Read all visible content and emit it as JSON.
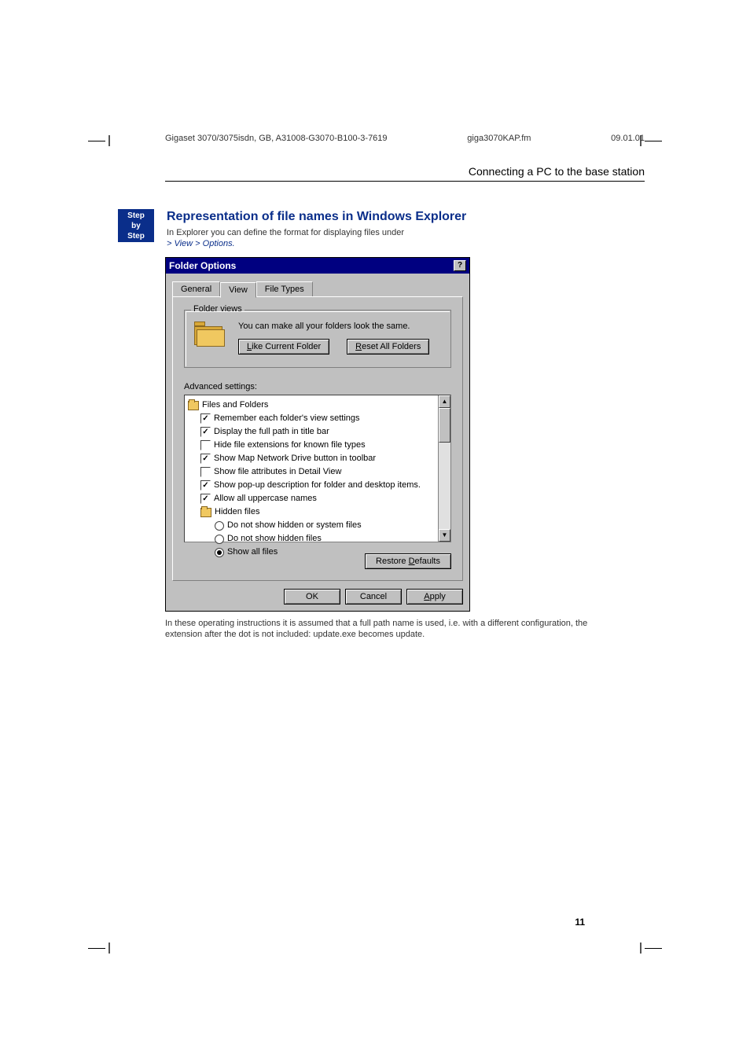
{
  "doc": {
    "header_left": "Gigaset 3070/3075isdn, GB, A31008-G3070-B100-3-7619",
    "header_mid": "giga3070KAP.fm",
    "header_right": "09.01.01",
    "section_title": "Connecting a PC to the base station",
    "step_badge_l1": "Step",
    "step_badge_l2": "by",
    "step_badge_l3": "Step",
    "heading": "Representation of file names in Windows Explorer",
    "intro_before": "In Explorer you can define the format for displaying files under",
    "menu_path": "> View > Options.",
    "outro": "In these operating instructions it is assumed that a full path name is used, i.e. with a different configuration, the extension after the dot is not included: update.exe becomes update.",
    "page_number": "11"
  },
  "dialog": {
    "title": "Folder Options",
    "help_btn": "?",
    "tabs": {
      "general": "General",
      "view": "View",
      "filetypes": "File Types"
    },
    "group_label": "Folder views",
    "folder_text": "You can make all your folders look the same.",
    "btn_like": "Like Current Folder",
    "btn_like_u": "L",
    "btn_reset": "Reset All Folders",
    "btn_reset_u": "R",
    "advanced_label": "Advanced settings:",
    "tree": {
      "root": "Files and Folders",
      "c1": "Remember each folder's view settings",
      "c2": "Display the full path in title bar",
      "c3": "Hide file extensions for known file types",
      "c4": "Show Map Network Drive button in toolbar",
      "c5": "Show file attributes in Detail View",
      "c6": "Show pop-up description for folder and desktop items.",
      "c7": "Allow all uppercase names",
      "sub": "Hidden files",
      "r1": "Do not show hidden or system files",
      "r2": "Do not show hidden files",
      "r3": "Show all files"
    },
    "btn_restore": "Restore Defaults",
    "btn_restore_u": "D",
    "btn_ok": "OK",
    "btn_cancel": "Cancel",
    "btn_apply": "Apply",
    "btn_apply_u": "A"
  }
}
